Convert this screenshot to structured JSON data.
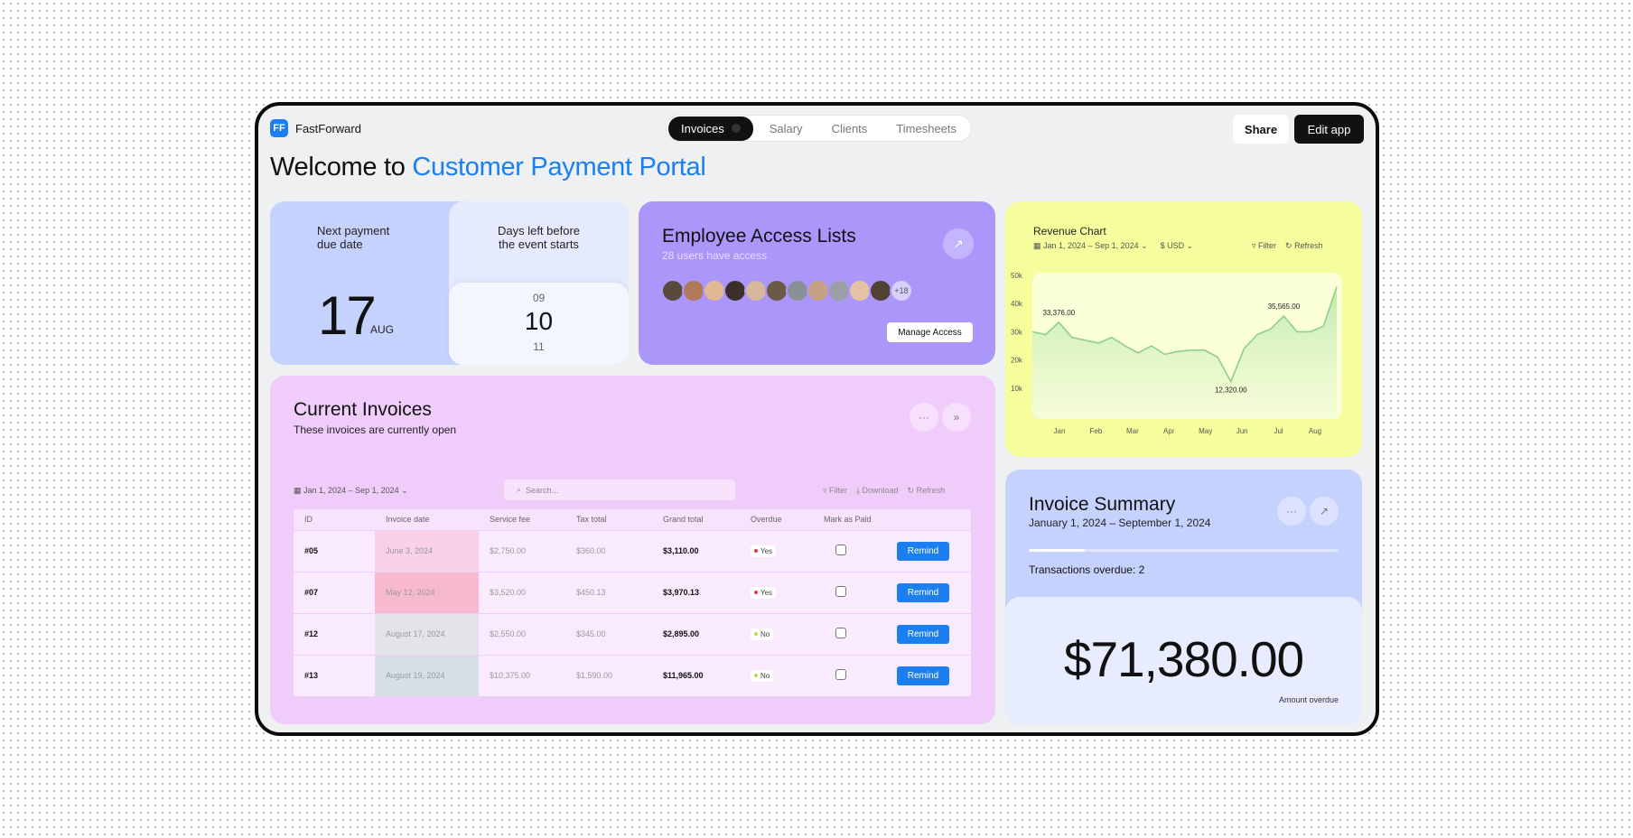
{
  "app": {
    "name": "FastForward",
    "logo": "FF"
  },
  "tabs": [
    {
      "label": "Invoices",
      "active": true
    },
    {
      "label": "Salary"
    },
    {
      "label": "Clients"
    },
    {
      "label": "Timesheets"
    }
  ],
  "header": {
    "share_label": "Share",
    "edit_label": "Edit app"
  },
  "welcome": {
    "prefix": "Welcome to ",
    "accent": "Customer Payment Portal"
  },
  "payment": {
    "label_line1": "Next payment",
    "label_line2": "due date",
    "day": "17",
    "month": "AUG"
  },
  "countdown": {
    "label_line1": "Days left before",
    "label_line2": "the event starts",
    "prev": "09",
    "current": "10",
    "next": "11"
  },
  "access": {
    "title": "Employee Access Lists",
    "subtitle": "28 users have access",
    "more": "+18",
    "manage_label": "Manage Access",
    "avatar_colors": [
      "#5a4a3e",
      "#b07a5a",
      "#e0b896",
      "#3c2f2a",
      "#d7b79c",
      "#6b5a48",
      "#8b8f98",
      "#c7a185",
      "#9aa0a6",
      "#e5c2a4",
      "#514036"
    ]
  },
  "revenue": {
    "title": "Revenue Chart",
    "date_range": "Jan 1, 2024 – Sep 1, 2024",
    "currency": "$ USD",
    "filter_label": "Filter",
    "refresh_label": "Refresh"
  },
  "chart_data": {
    "type": "area",
    "x": [
      "Jan",
      "",
      "",
      "Feb",
      "",
      "",
      "Mar",
      "",
      "",
      "Apr",
      "",
      "",
      "May",
      "",
      "",
      "Jun",
      "",
      "",
      "Jul",
      "",
      "",
      "Aug",
      "",
      ""
    ],
    "xticks": [
      "Jan",
      "Feb",
      "Mar",
      "Apr",
      "May",
      "Jun",
      "Jul",
      "Aug"
    ],
    "values": [
      30000,
      29000,
      33376,
      28000,
      27000,
      26000,
      28000,
      25000,
      22500,
      25000,
      22000,
      23000,
      23500,
      23500,
      21000,
      12320,
      24000,
      29000,
      31000,
      35565,
      30000,
      30000,
      32000,
      46000
    ],
    "annotations": [
      {
        "label": "33,376.00",
        "index": 2
      },
      {
        "label": "12,320.00",
        "index": 15
      },
      {
        "label": "35,565.00",
        "index": 19
      }
    ],
    "yticks": [
      "50k",
      "40k",
      "30k",
      "20k",
      "10k"
    ],
    "ylim": [
      0,
      50000
    ],
    "line_color": "#8fcf8a"
  },
  "invoices": {
    "title": "Current Invoices",
    "subtitle": "These invoices are currently open",
    "date_range": "Jan 1, 2024 – Sep 1, 2024",
    "search_placeholder": "Search...",
    "filter_label": "Filter",
    "download_label": "Download",
    "refresh_label": "Refresh",
    "columns": [
      "ID",
      "Invoice date",
      "Service fee",
      "Tax total",
      "Grand total",
      "Overdue",
      "Mark as Paid",
      ""
    ],
    "remind_label": "Remind",
    "rows": [
      {
        "id": "#05",
        "date": "June 3, 2024",
        "date_bg": "#f8d0e8",
        "fee": "$2,750.00",
        "tax": "$360.00",
        "total": "$3,110.00",
        "overdue": "Yes",
        "dot": "#e23b3b"
      },
      {
        "id": "#07",
        "date": "May 12, 2024",
        "date_bg": "#f7b9d0",
        "fee": "$3,520.00",
        "tax": "$450.13",
        "total": "$3,970.13",
        "overdue": "Yes",
        "dot": "#e23b3b"
      },
      {
        "id": "#12",
        "date": "August 17, 2024",
        "date_bg": "#e5e3ea",
        "fee": "$2,550.00",
        "tax": "$345.00",
        "total": "$2,895.00",
        "overdue": "No",
        "dot": "#b7e04a"
      },
      {
        "id": "#13",
        "date": "August 19, 2024",
        "date_bg": "#d4e0e6",
        "fee": "$10,375.00",
        "tax": "$1,590.00",
        "total": "$11,965.00",
        "overdue": "No",
        "dot": "#b7e04a"
      }
    ]
  },
  "summary": {
    "title": "Invoice Summary",
    "subtitle": "January 1, 2024 – September 1, 2024",
    "transactions": "Transactions overdue: 2",
    "progress": 0.18,
    "amount": "$71,380.00",
    "amount_label": "Amount overdue"
  },
  "colors": {
    "accent": "#1b7ff0",
    "dark": "#111111"
  }
}
